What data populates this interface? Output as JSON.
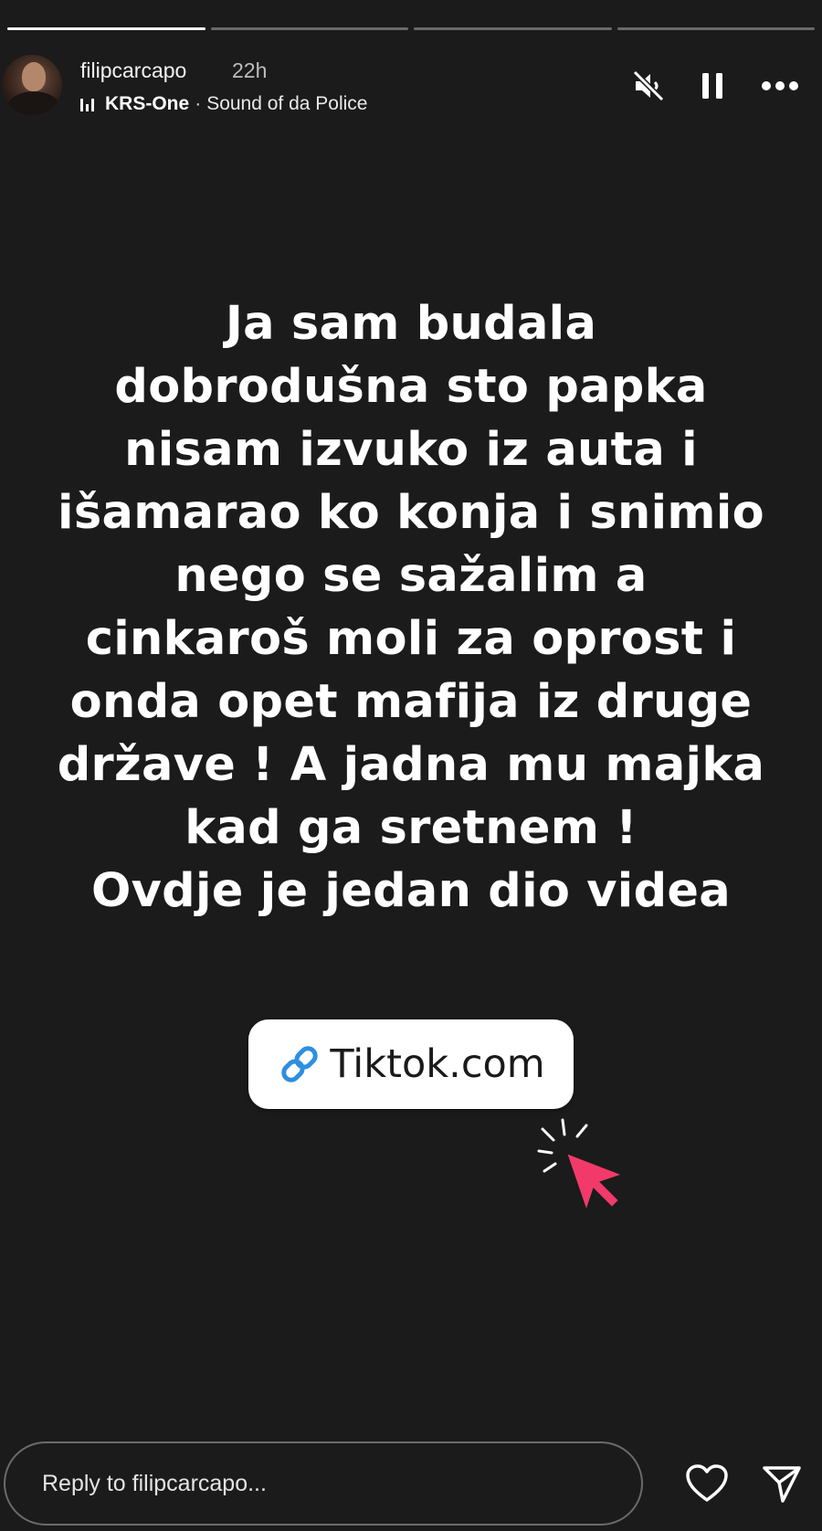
{
  "story": {
    "progress": [
      {
        "fill": 1.0
      },
      {
        "fill": 0.0
      },
      {
        "fill": 0.0
      },
      {
        "fill": 0.0
      }
    ]
  },
  "header": {
    "username": "filipcarcapo",
    "timestamp": "22h",
    "music": {
      "artist": "KRS-One",
      "separator": "·",
      "song": "Sound of da Police"
    },
    "icons": {
      "mute": "speaker-muted-icon",
      "pause": "pause-icon",
      "more": "more-horizontal-icon"
    }
  },
  "content": {
    "lines": [
      "Ja sam budala",
      "dobrodušna sto papka",
      "nisam izvuko iz auta i",
      "išamarao ko konja i snimio",
      "nego se sažalim a",
      "cinkaroš moli za oprost i",
      "onda opet mafija iz druge",
      "države ! A jadna mu majka",
      "kad ga sretnem !",
      "Ovdje je jedan dio videa"
    ],
    "link_sticker": {
      "label": "Tiktok.com",
      "icon": "link-icon",
      "icon_color": "#2d8fe0"
    },
    "cursor_graphic": {
      "icon": "pointer-cursor-icon",
      "color": "#f23a6a"
    }
  },
  "reply": {
    "placeholder": "Reply to filipcarcapo...",
    "value": "",
    "icons": {
      "like": "heart-icon",
      "share": "send-icon"
    }
  },
  "colors": {
    "background": "#1b1b1b",
    "text": "#ffffff",
    "accent_link": "#2d8fe0",
    "cursor": "#f23a6a"
  }
}
